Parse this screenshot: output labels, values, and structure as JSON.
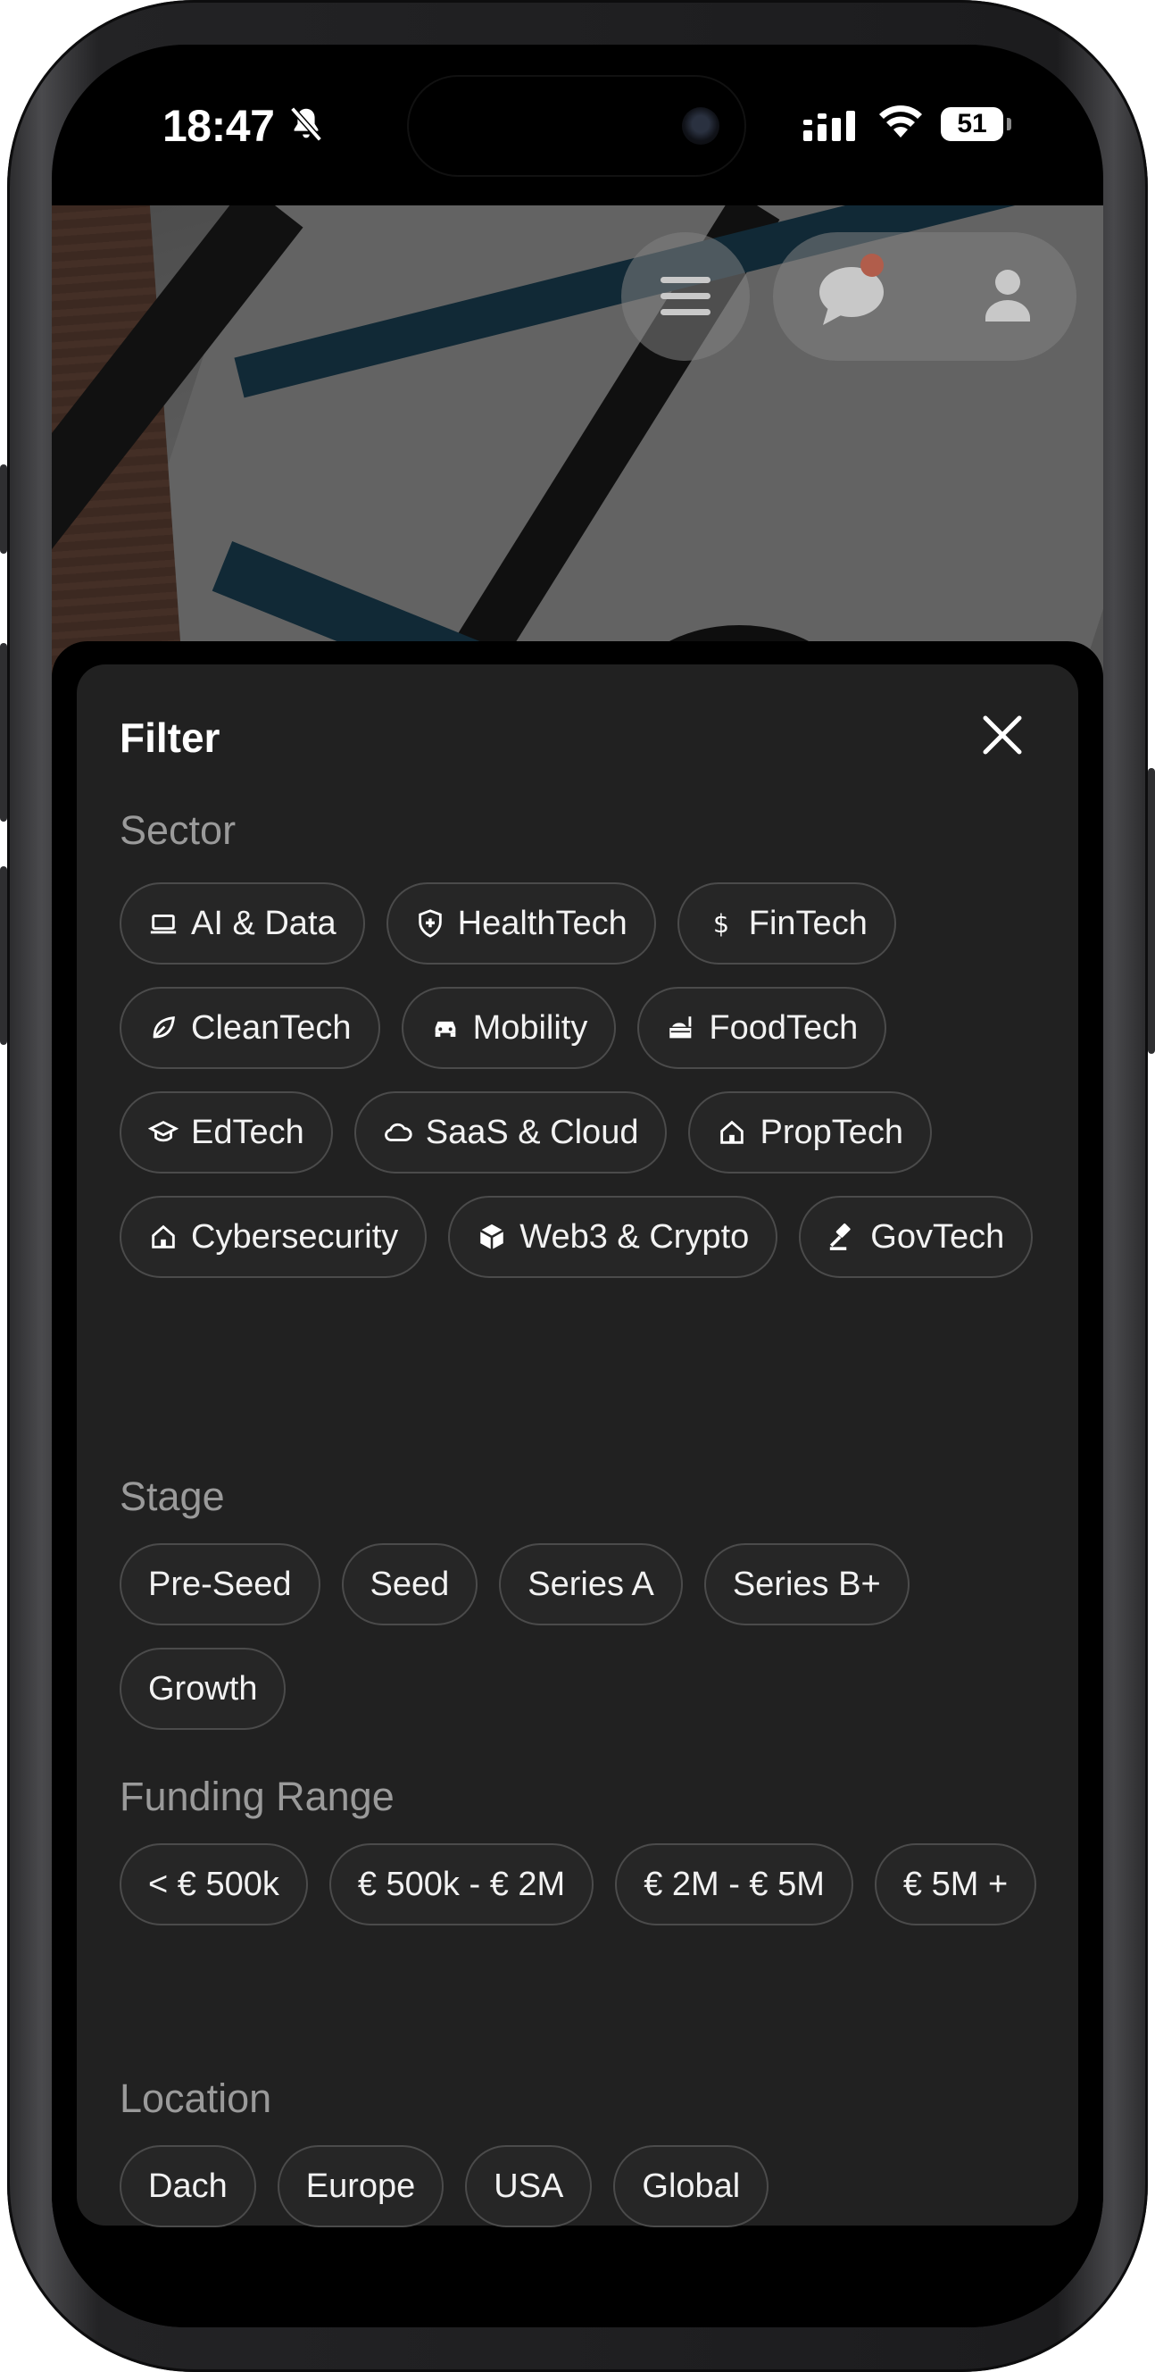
{
  "status_bar": {
    "time": "18:47",
    "battery": "51"
  },
  "filter": {
    "title": "Filter",
    "sector": {
      "label": "Sector",
      "chips": [
        {
          "label": "AI & Data",
          "icon": "laptop-icon"
        },
        {
          "label": "HealthTech",
          "icon": "health-shield-icon"
        },
        {
          "label": "FinTech",
          "icon": "dollar-icon"
        },
        {
          "label": "CleanTech",
          "icon": "leaf-icon"
        },
        {
          "label": "Mobility",
          "icon": "car-icon"
        },
        {
          "label": "FoodTech",
          "icon": "food-icon"
        },
        {
          "label": "EdTech",
          "icon": "graduation-cap-icon"
        },
        {
          "label": "SaaS & Cloud",
          "icon": "cloud-icon"
        },
        {
          "label": "PropTech",
          "icon": "house-icon"
        },
        {
          "label": "Cybersecurity",
          "icon": "house-icon"
        },
        {
          "label": "Web3 & Crypto",
          "icon": "cube-icon"
        },
        {
          "label": "GovTech",
          "icon": "gavel-icon"
        }
      ]
    },
    "stage": {
      "label": "Stage",
      "chips": [
        "Pre-Seed",
        "Seed",
        "Series A",
        "Series B+",
        "Growth"
      ]
    },
    "funding": {
      "label": "Funding Range",
      "chips": [
        "< € 500k",
        "€ 500k - € 2M",
        "€ 2M - € 5M",
        "€ 5M +"
      ]
    },
    "location": {
      "label": "Location",
      "chips": [
        "Dach",
        "Europe",
        "USA",
        "Global"
      ]
    }
  }
}
